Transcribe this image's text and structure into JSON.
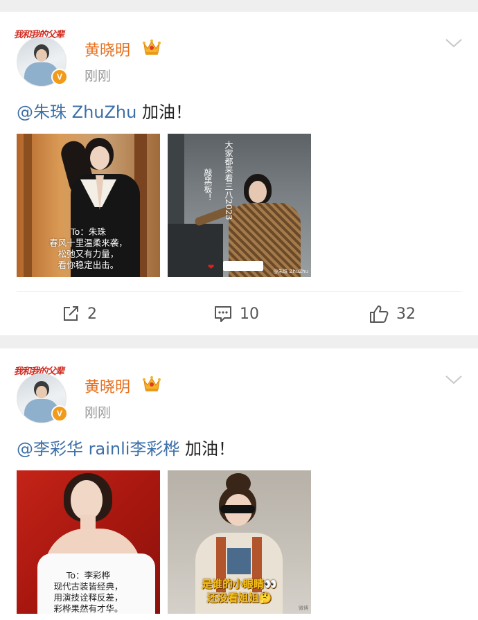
{
  "posts": [
    {
      "author": "黄晓明",
      "avatar_banner": "我和我的父辈",
      "verify_mark": "V",
      "time": "刚刚",
      "mention": "@朱珠 ZhuZhu",
      "text_suffix": " 加油！",
      "photos": [
        {
          "caption_lines": [
            "To：朱珠",
            "春风十里温柔来袭，",
            "松弛又有力量，",
            "看你稳定出击。"
          ]
        },
        {
          "overlay_text_1": "大家都来看三八2023",
          "overlay_text_2": "敲黑板！",
          "watermark": "@朱珠 ZhuZhu"
        }
      ],
      "repost_count": "2",
      "comment_count": "10",
      "like_count": "32"
    },
    {
      "author": "黄晓明",
      "avatar_banner": "我和我的父辈",
      "verify_mark": "V",
      "time": "刚刚",
      "mention": "@李彩华 rainli李彩桦",
      "text_suffix": " 加油！",
      "photos": [
        {
          "caption_lines": [
            "To：李彩桦",
            "现代古装皆经典，",
            "用演技诠释反差，",
            "彩桦果然有才华。"
          ]
        },
        {
          "overlay_line_1": "是谁的小眼睛👀",
          "overlay_line_2": "还没看姐姐🤔",
          "watermark": "微博"
        }
      ]
    }
  ],
  "colors": {
    "author": "#e8701f",
    "mention": "#3c6fa8",
    "time": "#999999",
    "background": "#efefef",
    "verify_badge": "#f29b1a"
  },
  "icons": [
    "crown-icon",
    "chevron-down-icon",
    "repost-icon",
    "comment-icon",
    "like-icon",
    "verified-icon"
  ]
}
